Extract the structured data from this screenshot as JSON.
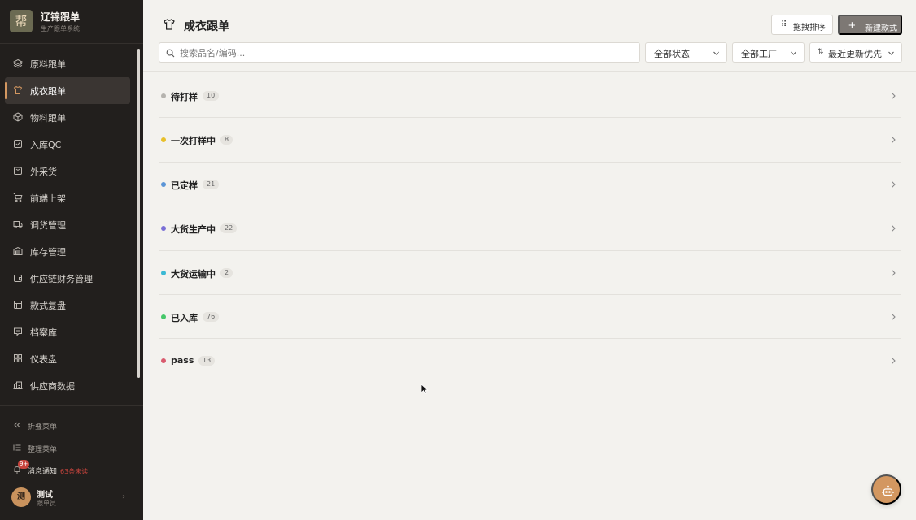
{
  "brand": {
    "logo_glyph": "帮",
    "title": "辽锦跟单",
    "subtitle": "生产跟单系统"
  },
  "sidebar": {
    "items": [
      {
        "label": "原料跟单",
        "icon": "layers-icon",
        "active": false
      },
      {
        "label": "成衣跟单",
        "icon": "shirt-icon",
        "active": true
      },
      {
        "label": "物料跟单",
        "icon": "box-icon",
        "active": false
      },
      {
        "label": "入库QC",
        "icon": "check-square-icon",
        "active": false
      },
      {
        "label": "外采货",
        "icon": "bag-icon",
        "active": false
      },
      {
        "label": "前端上架",
        "icon": "cart-icon",
        "active": false
      },
      {
        "label": "调货管理",
        "icon": "truck-icon",
        "active": false
      },
      {
        "label": "库存管理",
        "icon": "warehouse-icon",
        "active": false
      },
      {
        "label": "供应链财务管理",
        "icon": "wallet-icon",
        "active": false
      },
      {
        "label": "款式复盘",
        "icon": "table-icon",
        "active": false
      },
      {
        "label": "档案库",
        "icon": "archive-icon",
        "active": false
      },
      {
        "label": "仪表盘",
        "icon": "dashboard-icon",
        "active": false
      },
      {
        "label": "供应商数据",
        "icon": "building-icon",
        "active": false
      }
    ],
    "collapse_label": "折叠菜单",
    "organize_label": "整理菜单",
    "notifications": {
      "label": "消息通知",
      "badge": "9+",
      "unread": "63条未读"
    },
    "user": {
      "avatar": "测",
      "name": "测试",
      "role": "跟单员"
    }
  },
  "header": {
    "title": "成衣跟单",
    "sort_button": "拖拽排序",
    "new_button": "新建款式",
    "search_placeholder": "搜索品名/编码...",
    "status_filter": "全部状态",
    "factory_filter": "全部工厂",
    "sort_filter": "最近更新优先"
  },
  "groups": [
    {
      "label": "待打样",
      "count": "10",
      "color": "#b5b3ae"
    },
    {
      "label": "一次打样中",
      "count": "8",
      "color": "#e8c02a"
    },
    {
      "label": "已定样",
      "count": "21",
      "color": "#5b95d6"
    },
    {
      "label": "大货生产中",
      "count": "22",
      "color": "#7a6fd6"
    },
    {
      "label": "大货运输中",
      "count": "2",
      "color": "#3bb9d4"
    },
    {
      "label": "已入库",
      "count": "76",
      "color": "#45c769"
    },
    {
      "label": "pass",
      "count": "13",
      "color": "#d95b6e"
    }
  ],
  "colors": {
    "accent": "#d39760",
    "sidebar_bg": "#221f1d",
    "page_bg": "#f3f2ee",
    "new_button_bg": "#7d7874"
  }
}
